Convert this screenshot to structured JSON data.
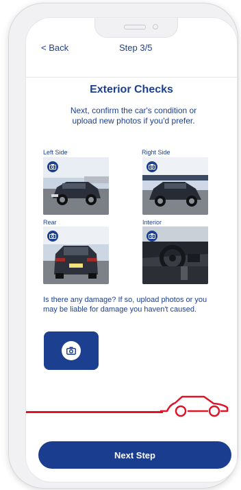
{
  "header": {
    "back_label": "< Back",
    "step_label": "Step 3/5"
  },
  "main": {
    "title": "Exterior Checks",
    "subtitle": "Next, confirm the car's condition or upload new photos if you'd prefer."
  },
  "photos": [
    {
      "label": "Left Side"
    },
    {
      "label": "Right Side"
    },
    {
      "label": "Rear"
    },
    {
      "label": "Interior"
    }
  ],
  "damage": {
    "prompt": "Is there any damage? If so, upload photos or you may be liable for damage you haven't caused."
  },
  "footer": {
    "next_label": "Next Step"
  },
  "colors": {
    "brand_blue": "#1d3f8f",
    "accent_red": "#e11226"
  },
  "icons": {
    "camera": "camera-icon",
    "car": "car-outline-icon"
  }
}
